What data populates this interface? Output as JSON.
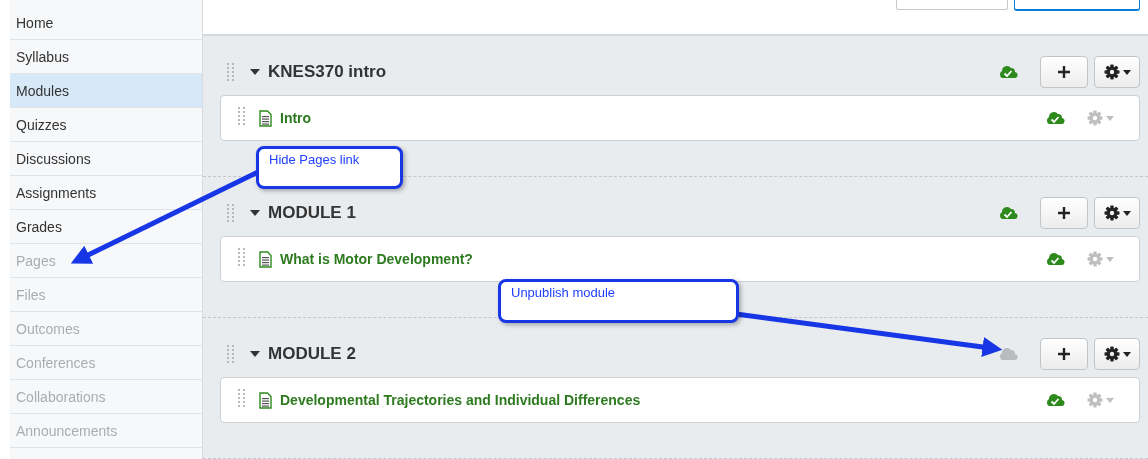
{
  "sidebar": {
    "items": [
      {
        "label": "Home",
        "selected": false,
        "hidden": false
      },
      {
        "label": "Syllabus",
        "selected": false,
        "hidden": false
      },
      {
        "label": "Modules",
        "selected": true,
        "hidden": false
      },
      {
        "label": "Quizzes",
        "selected": false,
        "hidden": false
      },
      {
        "label": "Discussions",
        "selected": false,
        "hidden": false
      },
      {
        "label": "Assignments",
        "selected": false,
        "hidden": false
      },
      {
        "label": "Grades",
        "selected": false,
        "hidden": false
      },
      {
        "label": "Pages",
        "selected": false,
        "hidden": true
      },
      {
        "label": "Files",
        "selected": false,
        "hidden": true
      },
      {
        "label": "Outcomes",
        "selected": false,
        "hidden": true
      },
      {
        "label": "Conferences",
        "selected": false,
        "hidden": true
      },
      {
        "label": "Collaborations",
        "selected": false,
        "hidden": true
      },
      {
        "label": "Announcements",
        "selected": false,
        "hidden": true
      }
    ]
  },
  "modules": [
    {
      "title": "KNES370 intro",
      "expanded": true,
      "published": true,
      "items": [
        {
          "title": "Intro",
          "published": true
        }
      ]
    },
    {
      "title": "MODULE 1",
      "expanded": true,
      "published": true,
      "items": [
        {
          "title": "What is Motor Development?",
          "published": true
        }
      ]
    },
    {
      "title": "MODULE 2",
      "expanded": true,
      "published": false,
      "items": [
        {
          "title": "Developmental Trajectories and Individual Differences",
          "published": true
        }
      ]
    }
  ],
  "callouts": [
    {
      "text": "Hide Pages link"
    },
    {
      "text": "Unpublish module"
    }
  ]
}
